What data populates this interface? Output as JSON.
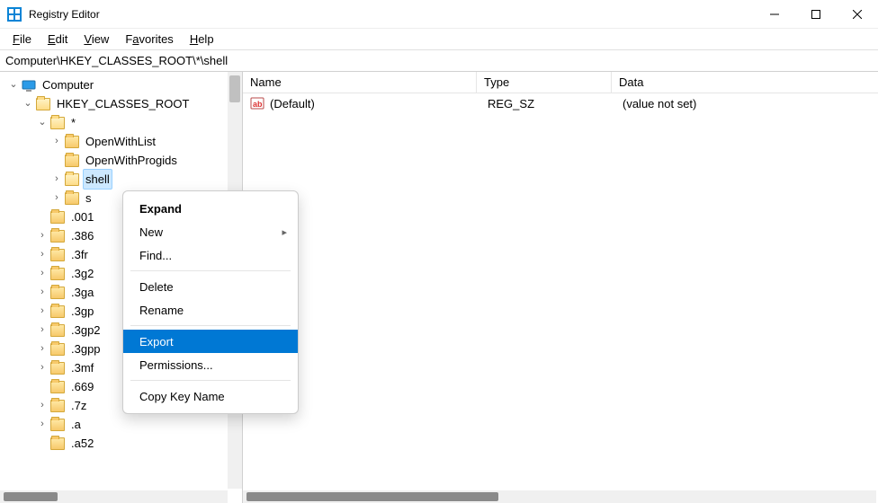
{
  "window": {
    "title": "Registry Editor"
  },
  "menubar": {
    "file": "File",
    "edit": "Edit",
    "view": "View",
    "favorites": "Favorites",
    "help": "Help"
  },
  "addressbar": {
    "path": "Computer\\HKEY_CLASSES_ROOT\\*\\shell"
  },
  "tree": {
    "root": "Computer",
    "hkcr": "HKEY_CLASSES_ROOT",
    "star": "*",
    "star_children": {
      "openwithlist": "OpenWithList",
      "openwithprogids": "OpenWithProgids",
      "shell": "shell",
      "shellex_truncated": "s"
    },
    "siblings": [
      ".001",
      ".386",
      ".3fr",
      ".3g2",
      ".3ga",
      ".3gp",
      ".3gp2",
      ".3gpp",
      ".3mf",
      ".669",
      ".7z",
      ".a",
      ".a52"
    ]
  },
  "list": {
    "headers": {
      "name": "Name",
      "type": "Type",
      "data": "Data"
    },
    "rows": [
      {
        "name": "(Default)",
        "type": "REG_SZ",
        "data": "(value not set)"
      }
    ]
  },
  "context_menu": {
    "expand": "Expand",
    "new": "New",
    "find": "Find...",
    "delete": "Delete",
    "rename": "Rename",
    "export": "Export",
    "permissions": "Permissions...",
    "copy_key_name": "Copy Key Name"
  }
}
